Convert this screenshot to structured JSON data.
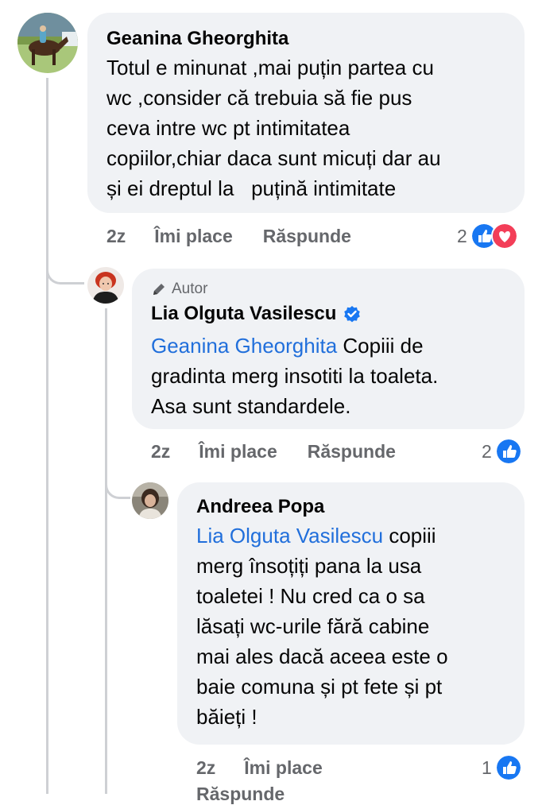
{
  "comments": [
    {
      "author": "Geanina Gheorghita",
      "text_lines": [
        "Totul e minunat ,mai puțin partea cu",
        "wc ,consider că trebuia să fie pus",
        "ceva intre wc pt intimitatea",
        "copiilor,chiar daca sunt micuți dar au",
        "și ei dreptul la   puțină intimitate"
      ],
      "time": "2z",
      "like_label": "Îmi place",
      "reply_label": "Răspunde",
      "reaction_count": "2",
      "reactions": [
        "like-reaction-icon",
        "love-reaction-icon"
      ]
    },
    {
      "author_tag": "Autor",
      "author": "Lia Olguta Vasilescu",
      "verified": true,
      "mention": "Geanina Gheorghita",
      "text_lines": [
        " Copiii de",
        "gradinta merg insotiti la toaleta.",
        "Asa sunt standardele."
      ],
      "time": "2z",
      "like_label": "Îmi place",
      "reply_label": "Răspunde",
      "reaction_count": "2",
      "reactions": [
        "like-reaction-icon"
      ]
    },
    {
      "author": "Andreea Popa",
      "mention": "Lia Olguta Vasilescu",
      "text_lines": [
        " copiii",
        "merg însoțiți pana la usa",
        "toaletei ! Nu cred ca o sa",
        "lăsați wc-urile fără cabine",
        "mai ales dacă aceea este o",
        "baie comuna și pt fete și pt",
        "băieți !"
      ],
      "time": "2z",
      "like_label": "Îmi place",
      "reply_label": "Răspunde",
      "reaction_count": "1",
      "reactions": [
        "like-reaction-icon"
      ]
    }
  ],
  "colors": {
    "bubble": "#f0f2f5",
    "mention": "#216fdb",
    "secondary_text": "#65676b",
    "like_blue": "#1877f2",
    "love_red": "#f33e58",
    "thread_line": "#ced0d4"
  }
}
